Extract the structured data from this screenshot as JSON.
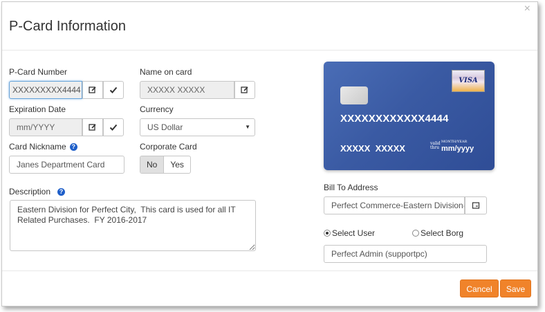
{
  "dialog": {
    "title": "P-Card Information",
    "close_symbol": "×"
  },
  "form": {
    "pcard_number": {
      "label": "P-Card Number",
      "value": "XXXXXXXXX4444"
    },
    "name_on_card": {
      "label": "Name on card",
      "value": "XXXXX XXXXX"
    },
    "expiration_date": {
      "label": "Expiration Date",
      "placeholder": "mm/YYYY"
    },
    "currency": {
      "label": "Currency",
      "value": "US Dollar"
    },
    "card_nickname": {
      "label": "Card Nickname",
      "value": "Janes Department Card"
    },
    "corporate_card": {
      "label": "Corporate Card",
      "options": [
        "No",
        "Yes"
      ],
      "selected": "No"
    },
    "description": {
      "label": "Description",
      "value": "Eastern Division for Perfect City,  This card is used for all IT Related Purchases.  FY 2016-2017"
    },
    "bill_to_address": {
      "label": "Bill To Address",
      "value": "Perfect Commerce-Eastern Division-"
    },
    "select_user_label": "Select User",
    "select_borg_label": "Select Borg",
    "selected_user": "Perfect Admin (supportpc)"
  },
  "card_preview": {
    "brand": "VISA",
    "number": "XXXXXXXXXXXX4444",
    "name": "XXXXX  XXXXX",
    "valid_label": "valid\nthru",
    "mmyy_label": "MONTH/YEAR",
    "expiry": "mm/yyyy"
  },
  "footer": {
    "cancel_label": "Cancel",
    "save_label": "Save"
  },
  "help_symbol": "?",
  "icons": {
    "edit": "edit-icon",
    "check": "check-icon",
    "caret": "caret-down-icon"
  },
  "colors": {
    "accent": "#f0832a",
    "help": "#1f5fc9",
    "card": "#3a5aa3"
  }
}
